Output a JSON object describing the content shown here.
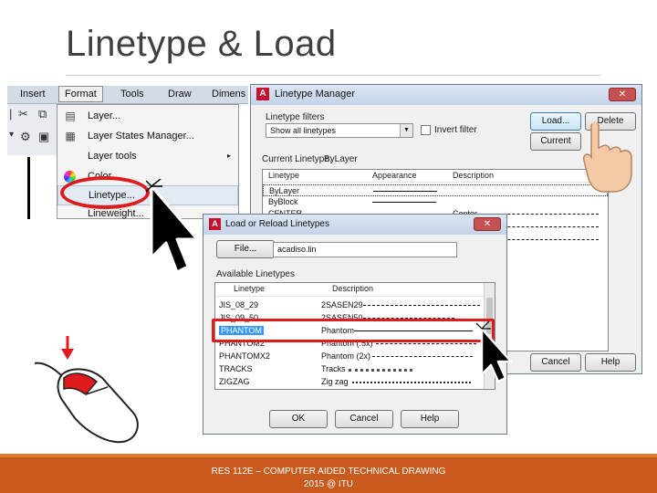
{
  "slide": {
    "title": "Linetype & Load",
    "footer_line1": "RES 112E – COMPUTER AIDED TECHNICAL DRAWING",
    "footer_line2": "2015 @ ITU"
  },
  "menubar": {
    "items": [
      "Insert",
      "Format",
      "Tools",
      "Draw",
      "Dimens"
    ]
  },
  "format_menu": {
    "items": [
      {
        "label": "Layer...",
        "icon": "layer-icon"
      },
      {
        "label": "Layer States Manager...",
        "icon": "layer-states-icon"
      },
      {
        "label": "Layer tools",
        "icon": "none",
        "submenu": "▸"
      },
      {
        "label": "Color...",
        "icon": "color-wheel-icon"
      },
      {
        "label": "Linetype...",
        "icon": "none"
      },
      {
        "label": "Lineweight...",
        "icon": "none"
      }
    ]
  },
  "linetype_manager": {
    "title": "Linetype Manager",
    "close": "✕",
    "filters_label": "Linetype filters",
    "filter_value": "Show all linetypes",
    "invert_filter": "Invert filter",
    "load_button": "Load...",
    "delete_button": "Delete",
    "current_button": "Current",
    "current_linetype_label": "Current Linetype:",
    "current_linetype_value": "ByLayer",
    "columns": [
      "Linetype",
      "Appearance",
      "Description"
    ],
    "rows": [
      {
        "name": "ByLayer",
        "desc": ""
      },
      {
        "name": "ByBlock",
        "desc": ""
      },
      {
        "name": "CENTER",
        "desc": "Center"
      }
    ],
    "cancel_button": "Cancel",
    "help_button": "Help"
  },
  "load_dialog": {
    "title": "Load or Reload Linetypes",
    "close": "✕",
    "file_button": "File...",
    "file_value": "acadiso.lin",
    "available_label": "Available Linetypes",
    "columns": [
      "Linetype",
      "Description"
    ],
    "rows": [
      {
        "name": "JIS_08_29",
        "desc": "2SASEN29"
      },
      {
        "name": "JIS_09_50",
        "desc": "2SASEN50"
      },
      {
        "name": "PHANTOM",
        "desc": "Phantom"
      },
      {
        "name": "PHANTOM2",
        "desc": "Phantom (.5x)"
      },
      {
        "name": "PHANTOMX2",
        "desc": "Phantom (2x)"
      },
      {
        "name": "TRACKS",
        "desc": "Tracks"
      },
      {
        "name": "ZIGZAG",
        "desc": "Zig zag"
      }
    ],
    "selected_index": 2,
    "ok_button": "OK",
    "cancel_button": "Cancel",
    "help_button": "Help"
  },
  "colors": {
    "accent_red": "#e01b1b",
    "footer": "#c95a1e",
    "selection": "#3399ff"
  }
}
